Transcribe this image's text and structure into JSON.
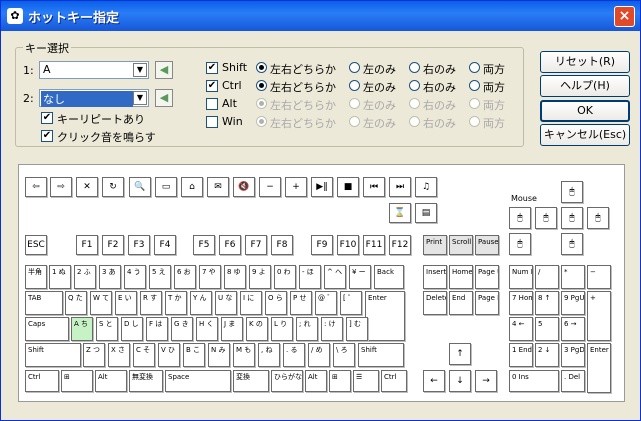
{
  "window": {
    "title": "ホットキー指定",
    "icon": "hotkey-app-icon",
    "close": "×"
  },
  "group": {
    "title": "キー選択",
    "row1": {
      "label": "1:",
      "value": "A"
    },
    "row2": {
      "label": "2:",
      "value": "なし"
    },
    "repeat": "キーリピートあり",
    "click_sound": "クリック音を鳴らす"
  },
  "modifiers": [
    {
      "name": "Shift",
      "checked": true,
      "disabled": false
    },
    {
      "name": "Ctrl",
      "checked": true,
      "disabled": false
    },
    {
      "name": "Alt",
      "checked": false,
      "disabled": true
    },
    {
      "name": "Win",
      "checked": false,
      "disabled": true
    }
  ],
  "options": [
    "左右どちらか",
    "左のみ",
    "右のみ",
    "両方"
  ],
  "buttons": {
    "reset": "リセット(R)",
    "help": "ヘルプ(H)",
    "ok": "OK",
    "cancel": "キャンセル(Esc)"
  },
  "keyboard": {
    "mouse_label": "Mouse",
    "selected_key": "A"
  }
}
